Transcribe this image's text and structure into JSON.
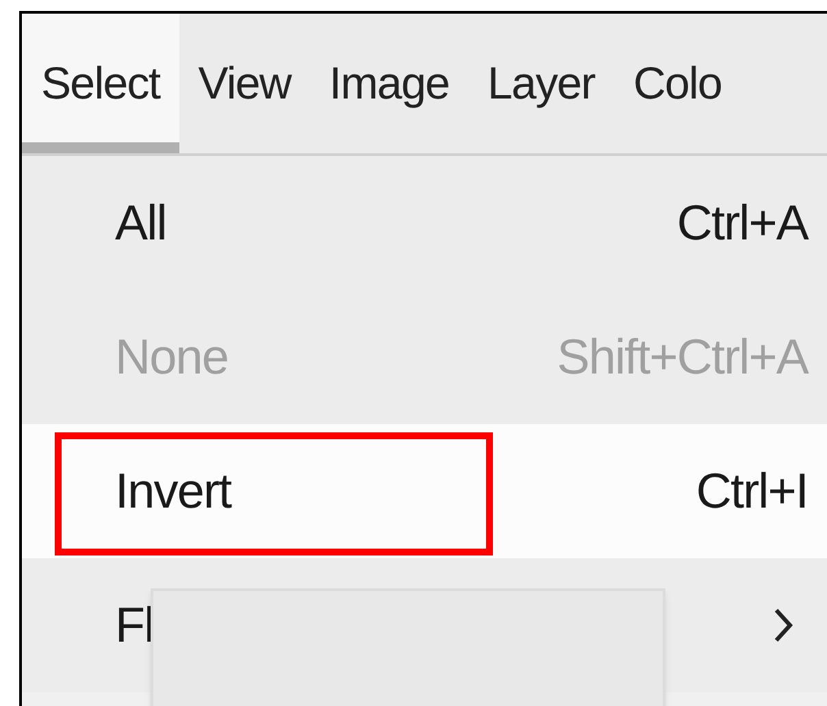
{
  "menubar": [
    {
      "label": "Select",
      "selected": true
    },
    {
      "label": "View",
      "selected": false
    },
    {
      "label": "Image",
      "selected": false
    },
    {
      "label": "Layer",
      "selected": false
    },
    {
      "label": "Colo",
      "selected": false
    }
  ],
  "menu": [
    {
      "kind": "command",
      "label": "All",
      "shortcut": "Ctrl+A",
      "disabled": false,
      "hovered": false,
      "highlighted": false
    },
    {
      "kind": "command",
      "label": "None",
      "shortcut": "Shift+Ctrl+A",
      "disabled": true,
      "hovered": false,
      "highlighted": false
    },
    {
      "kind": "command",
      "label": "Invert",
      "shortcut": "Ctrl+I",
      "disabled": false,
      "hovered": true,
      "highlighted": true
    },
    {
      "kind": "submenu",
      "label": "Fl",
      "disabled": false,
      "hovered": false,
      "highlighted": false
    }
  ],
  "tooltip": {
    "visible": true
  }
}
